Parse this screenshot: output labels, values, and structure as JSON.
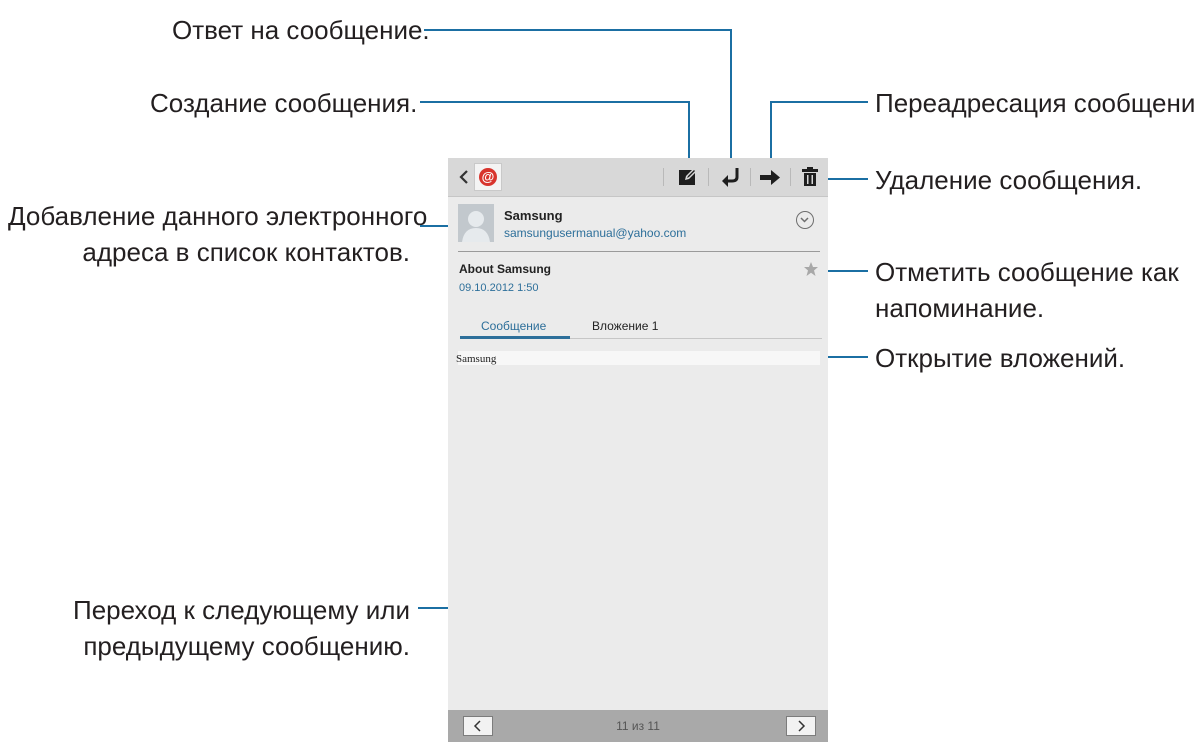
{
  "callouts": {
    "reply": "Ответ на сообщение.",
    "compose": "Создание сообщения.",
    "forward": "Переадресация сообщения.",
    "delete": "Удаление сообщения.",
    "add_contact_line1": "Добавление данного электронного",
    "add_contact_line2": "адреса в список контактов.",
    "mark_line1": "Отметить сообщение как",
    "mark_line2": "напоминание.",
    "open_attachments": "Открытие вложений.",
    "navigate_line1": "Переход к следующему или",
    "navigate_line2": "предыдущему сообщению."
  },
  "app_icon": {
    "symbol": "@",
    "icon": "email-app-icon"
  },
  "toolbar": {
    "compose_icon": "compose-icon",
    "reply_icon": "reply-icon",
    "forward_icon": "forward-icon",
    "delete_icon": "trash-icon"
  },
  "message": {
    "sender_name": "Samsung",
    "sender_email": "samsungusermanual@yahoo.com",
    "subject": "About Samsung",
    "date": "09.10.2012  1:50",
    "body": "Samsung"
  },
  "tabs": [
    {
      "label": "Сообщение",
      "active": true
    },
    {
      "label": "Вложение 1",
      "active": false
    }
  ],
  "footer": {
    "counter": "11 из 11"
  },
  "colors": {
    "accent": "#2d6f9a",
    "leader_line": "#1b6fa3",
    "toolbar_bg": "#d8d8d8",
    "screen_bg": "#ebebeb"
  }
}
